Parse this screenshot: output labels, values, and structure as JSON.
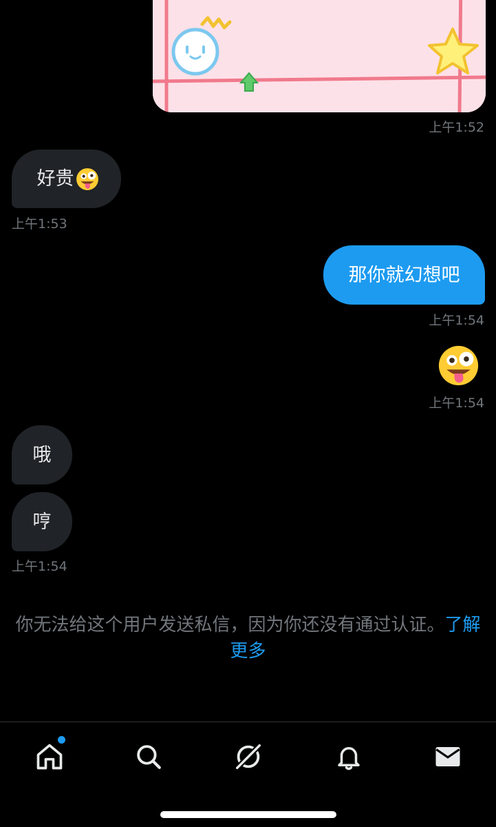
{
  "messages": {
    "image_msg": {
      "time": "上午1:52"
    },
    "msg1": {
      "text": "好贵",
      "emoji": "zany-face",
      "time": "上午1:53"
    },
    "msg2": {
      "text": "那你就幻想吧",
      "time": "上午1:54"
    },
    "msg3": {
      "emoji": "zany-face",
      "time": "上午1:54"
    },
    "msg4": {
      "text": "哦"
    },
    "msg5": {
      "text": "哼",
      "time": "上午1:54"
    }
  },
  "notice": {
    "text": "你无法给这个用户发送私信，因为你还没有通过认证。",
    "link": "了解更多"
  },
  "tabbar": {
    "tabs": [
      "home-icon",
      "search-icon",
      "grok-icon",
      "bell-icon",
      "mail-icon"
    ],
    "home_has_badge": true
  },
  "colors": {
    "accent": "#1d9bf0",
    "incoming_bubble": "#202327",
    "timestamp": "#71767b"
  }
}
